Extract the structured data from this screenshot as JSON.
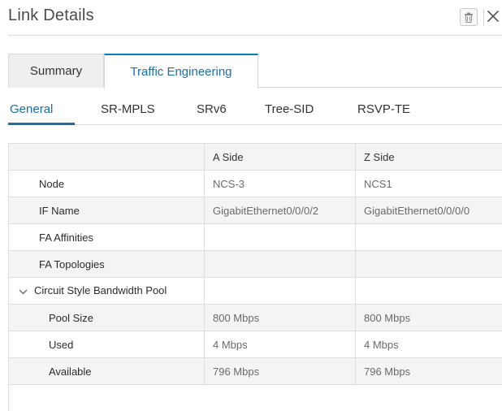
{
  "dialog": {
    "title": "Link Details"
  },
  "header_icons": {
    "delete": "trash-icon",
    "close": "close-icon"
  },
  "tabs": [
    {
      "label": "Summary",
      "active": false
    },
    {
      "label": "Traffic Engineering",
      "active": true
    }
  ],
  "subtabs": [
    {
      "label": "General",
      "active": true
    },
    {
      "label": "SR-MPLS",
      "active": false
    },
    {
      "label": "SRv6",
      "active": false
    },
    {
      "label": "Tree-SID",
      "active": false
    },
    {
      "label": "RSVP-TE",
      "active": false
    }
  ],
  "table": {
    "columns": [
      "",
      "A Side",
      "Z Side"
    ],
    "rows": [
      {
        "label": "Node",
        "a": "NCS-3",
        "z": "NCS1"
      },
      {
        "label": "IF Name",
        "a": "GigabitEthernet0/0/0/2",
        "z": "GigabitEthernet0/0/0/0"
      },
      {
        "label": "FA Affinities",
        "a": "",
        "z": ""
      },
      {
        "label": "FA Topologies",
        "a": "",
        "z": ""
      },
      {
        "label": "Circuit Style Bandwidth Pool",
        "a": "",
        "z": "",
        "expanded": true
      },
      {
        "label": "Pool Size",
        "a": "800 Mbps",
        "z": "800 Mbps"
      },
      {
        "label": "Used",
        "a": "4 Mbps",
        "z": "4 Mbps"
      },
      {
        "label": "Available",
        "a": "796 Mbps",
        "z": "796 Mbps"
      }
    ]
  },
  "colors": {
    "accent": "#1a6fa8",
    "tab_border_active": "#0a7bbf",
    "row_alt": "#f4f4f4",
    "border": "#dedede"
  }
}
